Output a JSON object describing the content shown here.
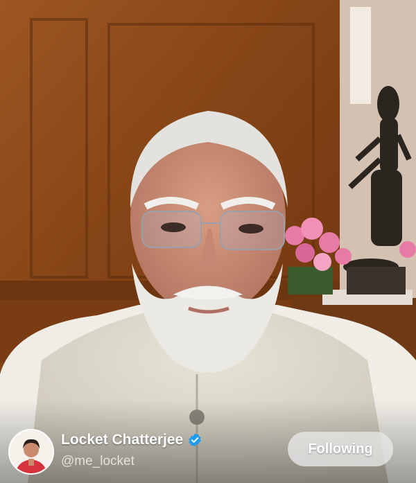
{
  "post": {
    "author": {
      "display_name": "Locket Chatterjee",
      "handle": "@me_locket",
      "verified": true,
      "verified_icon": "verified-badge-icon",
      "verified_color": "#1d9bf0"
    },
    "follow_button": {
      "label": "Following"
    }
  },
  "colors": {
    "wood_panel": "#8a4a1c",
    "wall": "#d9c7b8",
    "vest": "#ddd9cc",
    "flowers": "#e77ba5"
  }
}
